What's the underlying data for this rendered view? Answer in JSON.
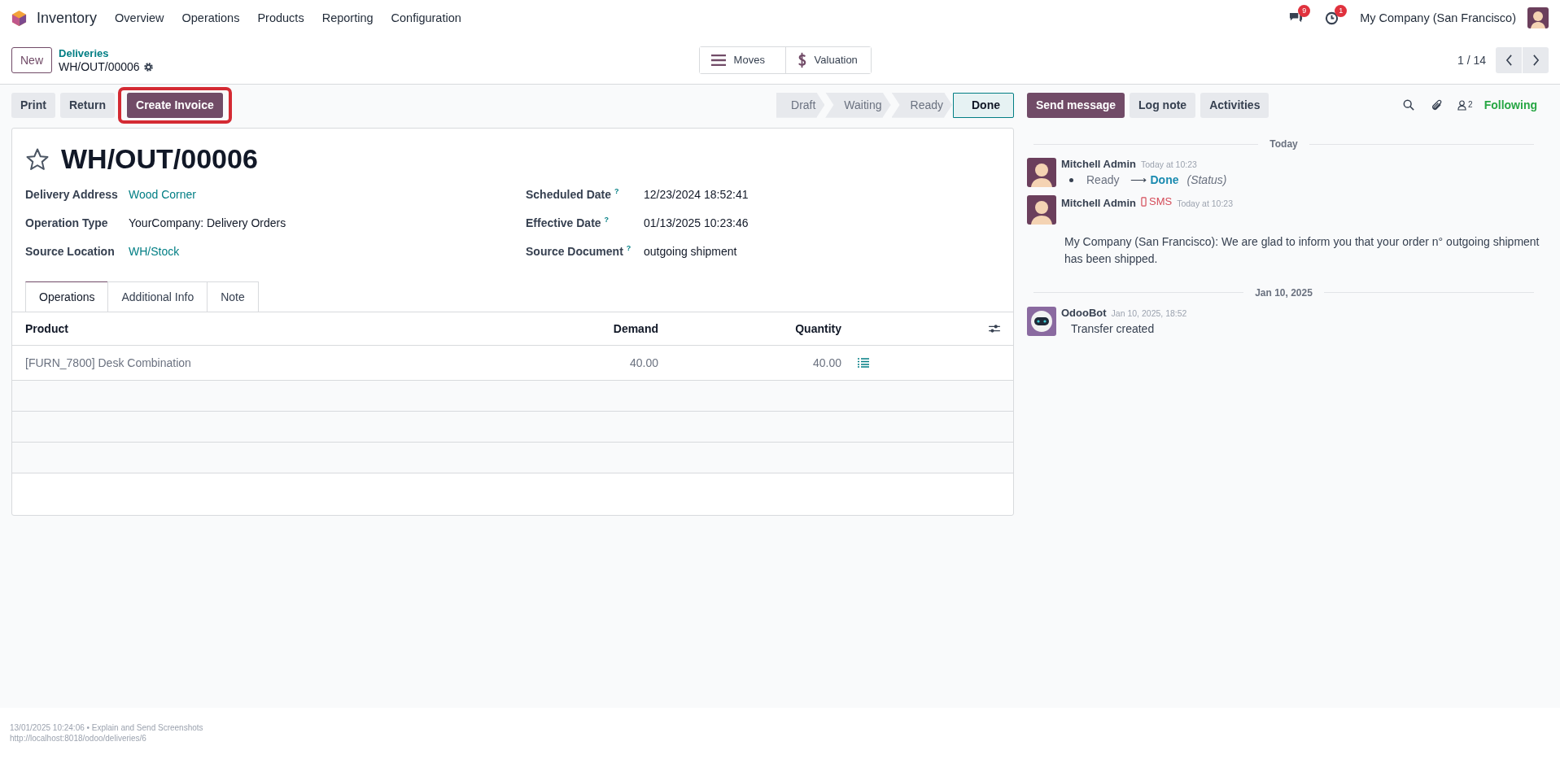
{
  "navbar": {
    "app_name": "Inventory",
    "menu": [
      "Overview",
      "Operations",
      "Products",
      "Reporting",
      "Configuration"
    ],
    "messages_badge": "9",
    "activities_badge": "1",
    "company": "My Company (San Francisco)"
  },
  "control_panel": {
    "new_button": "New",
    "breadcrumb": "Deliveries",
    "record_name": "WH/OUT/00006",
    "smart_buttons": [
      {
        "kind": "moves",
        "label": "Moves"
      },
      {
        "kind": "valuation",
        "label": "Valuation"
      }
    ],
    "pager": "1 / 14"
  },
  "actions": [
    {
      "label": "Print",
      "primary": false,
      "highlighted": false
    },
    {
      "label": "Return",
      "primary": false,
      "highlighted": false
    },
    {
      "label": "Create Invoice",
      "primary": true,
      "highlighted": true
    }
  ],
  "statusbar": [
    {
      "label": "Draft",
      "selected": false
    },
    {
      "label": "Waiting",
      "selected": false
    },
    {
      "label": "Ready",
      "selected": false
    },
    {
      "label": "Done",
      "selected": true
    }
  ],
  "form": {
    "title": "WH/OUT/00006",
    "starred": false,
    "left_fields": [
      {
        "label": "Delivery Address",
        "value": "Wood Corner",
        "link": true
      },
      {
        "label": "Operation Type",
        "value": "YourCompany: Delivery Orders",
        "link": false
      },
      {
        "label": "Source Location",
        "value": "WH/Stock",
        "link": true
      }
    ],
    "right_fields": [
      {
        "label": "Scheduled Date",
        "help": "?",
        "value": "12/23/2024 18:52:41"
      },
      {
        "label": "Effective Date",
        "help": "?",
        "value": "01/13/2025 10:23:46"
      },
      {
        "label": "Source Document",
        "help": "?",
        "value": "outgoing shipment"
      }
    ],
    "tabs": [
      {
        "label": "Operations",
        "selected": true
      },
      {
        "label": "Additional Info",
        "selected": false
      },
      {
        "label": "Note",
        "selected": false
      }
    ],
    "table": {
      "columns": [
        "Product",
        "Demand",
        "Quantity"
      ],
      "rows": [
        {
          "product": "[FURN_7800] Desk Combination",
          "demand": "40.00",
          "quantity": "40.00"
        }
      ]
    }
  },
  "chatter": {
    "buttons": [
      {
        "label": "Send message",
        "primary": true
      },
      {
        "label": "Log note",
        "primary": false
      },
      {
        "label": "Activities",
        "primary": false
      }
    ],
    "followers_count": "2",
    "following": "Following",
    "groups": [
      {
        "date": "Today",
        "messages": [
          {
            "kind": "tracking",
            "author": "Mitchell Admin",
            "time": "Today at 10:23",
            "old": "Ready",
            "arrow": "⟶",
            "new": "Done",
            "field": "(Status)"
          },
          {
            "kind": "sms",
            "author": "Mitchell Admin",
            "channel": "SMS",
            "time": "Today at 10:23",
            "body": "My Company (San Francisco): We are glad to inform you that your order n° outgoing shipment has been shipped."
          }
        ]
      },
      {
        "date": "Jan 10, 2025",
        "messages": [
          {
            "kind": "bot",
            "author": "OdooBot",
            "time": "Jan 10, 2025, 18:52",
            "body": "Transfer created"
          }
        ]
      }
    ]
  },
  "footer": {
    "line_1": "13/01/2025 10:24:06 • Explain and Send Screenshots",
    "line_2": "http://localhost:8018/odoo/deliveries/6"
  }
}
